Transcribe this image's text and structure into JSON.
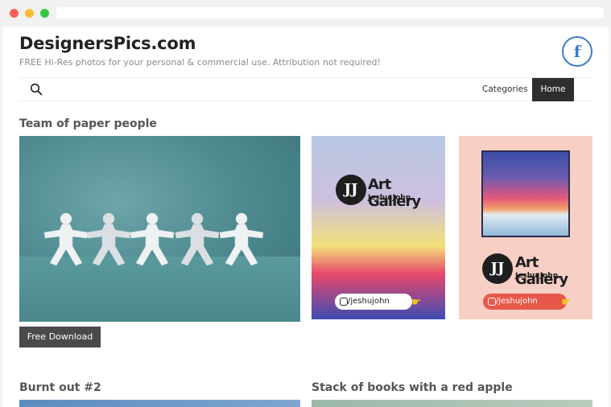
{
  "site": {
    "title": "DesignersPics.com",
    "tagline": "FREE Hi-Res photos for your personal & commercial use. Attribution not required!"
  },
  "social": {
    "facebook_glyph": "f"
  },
  "nav": {
    "categories_label": "Categories",
    "home_label": "Home"
  },
  "posts": [
    {
      "title": "Team of paper people",
      "download_label": "Free Download"
    },
    {
      "title": "Burnt out #2"
    },
    {
      "title": "Stack of books with a red apple"
    }
  ],
  "ads": [
    {
      "brand_line1": "Art Gallery",
      "brand_line2": "Jeshu John",
      "handle": "/jeshujohn",
      "logo_glyph": "JJ"
    },
    {
      "brand_line1": "Art Gallery",
      "brand_line2": "Jeshu John",
      "handle": "/jeshujohn",
      "logo_glyph": "JJ"
    }
  ],
  "colors": {
    "accent_dark": "#2e2e2e",
    "facebook_blue": "#3b7fc4",
    "pill_orange": "#e8584a"
  }
}
